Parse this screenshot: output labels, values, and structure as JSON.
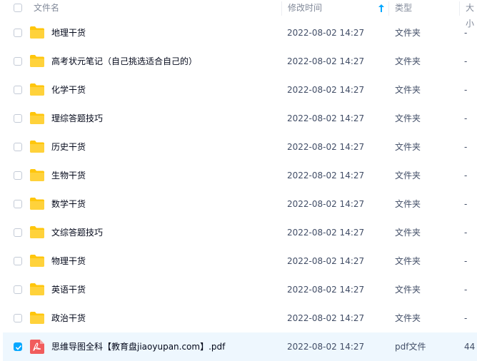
{
  "header": {
    "col_name": "文件名",
    "col_modified": "修改时间",
    "col_type": "类型",
    "col_size": "大小"
  },
  "rows": [
    {
      "name": "地理干货",
      "modified": "2022-08-02 14:27",
      "type": "文件夹",
      "size": "-",
      "icon": "folder-icon",
      "selected": false
    },
    {
      "name": "高考状元笔记（自己挑选适合自己的）",
      "modified": "2022-08-02 14:27",
      "type": "文件夹",
      "size": "-",
      "icon": "folder-icon",
      "selected": false
    },
    {
      "name": "化学干货",
      "modified": "2022-08-02 14:27",
      "type": "文件夹",
      "size": "-",
      "icon": "folder-icon",
      "selected": false
    },
    {
      "name": "理综答题技巧",
      "modified": "2022-08-02 14:27",
      "type": "文件夹",
      "size": "-",
      "icon": "folder-icon",
      "selected": false
    },
    {
      "name": "历史干货",
      "modified": "2022-08-02 14:27",
      "type": "文件夹",
      "size": "-",
      "icon": "folder-icon",
      "selected": false
    },
    {
      "name": "生物干货",
      "modified": "2022-08-02 14:27",
      "type": "文件夹",
      "size": "-",
      "icon": "folder-icon",
      "selected": false
    },
    {
      "name": "数学干货",
      "modified": "2022-08-02 14:27",
      "type": "文件夹",
      "size": "-",
      "icon": "folder-icon",
      "selected": false
    },
    {
      "name": "文综答题技巧",
      "modified": "2022-08-02 14:27",
      "type": "文件夹",
      "size": "-",
      "icon": "folder-icon",
      "selected": false
    },
    {
      "name": "物理干货",
      "modified": "2022-08-02 14:27",
      "type": "文件夹",
      "size": "-",
      "icon": "folder-icon",
      "selected": false
    },
    {
      "name": "英语干货",
      "modified": "2022-08-02 14:27",
      "type": "文件夹",
      "size": "-",
      "icon": "folder-icon",
      "selected": false
    },
    {
      "name": "政治干货",
      "modified": "2022-08-02 14:27",
      "type": "文件夹",
      "size": "-",
      "icon": "folder-icon",
      "selected": false
    },
    {
      "name": "思维导图全科【教育盘jiaoyupan.com】.pdf",
      "modified": "2022-08-02 14:27",
      "type": "pdf文件",
      "size": "44",
      "icon": "pdf-icon",
      "selected": true
    }
  ],
  "colors": {
    "accent": "#06a7ff",
    "folder": "#ffc60c",
    "pdf": "#f15c5c",
    "selected_row": "#eef7fe"
  }
}
